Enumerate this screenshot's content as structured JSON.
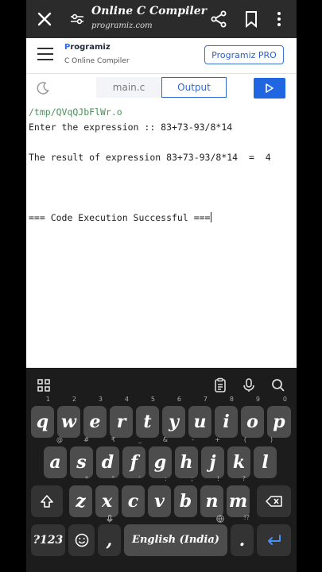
{
  "browser": {
    "title": "Online C Compiler",
    "url": "programiz.com"
  },
  "site": {
    "logo_brand": "rogramiz",
    "logo_initial": "P",
    "subtitle": "C Online Compiler",
    "pro_button": "Programiz PRO"
  },
  "toolbar": {
    "file_tab": "main.c",
    "output_tab": "Output"
  },
  "output": {
    "lines": [
      "/tmp/QVqQJbFlWr.o",
      "Enter the expression :: 83+73-93/8*14",
      "",
      "The result of expression 83+73-93/8*14  =  4",
      "",
      "",
      "",
      "=== Code Execution Successful ==="
    ]
  },
  "keyboard": {
    "row1": [
      {
        "k": "q",
        "n": "1"
      },
      {
        "k": "w",
        "n": "2"
      },
      {
        "k": "e",
        "n": "3"
      },
      {
        "k": "r",
        "n": "4"
      },
      {
        "k": "t",
        "n": "5"
      },
      {
        "k": "y",
        "n": "6"
      },
      {
        "k": "u",
        "n": "7"
      },
      {
        "k": "i",
        "n": "8"
      },
      {
        "k": "o",
        "n": "9"
      },
      {
        "k": "p",
        "n": "0"
      }
    ],
    "row2": [
      {
        "k": "a",
        "n": "@"
      },
      {
        "k": "s",
        "n": "#"
      },
      {
        "k": "d",
        "n": "₹"
      },
      {
        "k": "f",
        "n": "_"
      },
      {
        "k": "g",
        "n": "&"
      },
      {
        "k": "h",
        "n": "-"
      },
      {
        "k": "j",
        "n": "+"
      },
      {
        "k": "k",
        "n": "("
      },
      {
        "k": "l",
        "n": ")"
      }
    ],
    "row3": [
      {
        "k": "z",
        "n": "*"
      },
      {
        "k": "x",
        "n": "\""
      },
      {
        "k": "c",
        "n": "'"
      },
      {
        "k": "v",
        "n": ":"
      },
      {
        "k": "b",
        "n": ";"
      },
      {
        "k": "n",
        "n": "!"
      },
      {
        "k": "m",
        "n": "?"
      }
    ],
    "symbols_key": "?123",
    "comma_key": ",",
    "space_label": "English (India)",
    "period_key": ".",
    "period_hint": "!?"
  }
}
